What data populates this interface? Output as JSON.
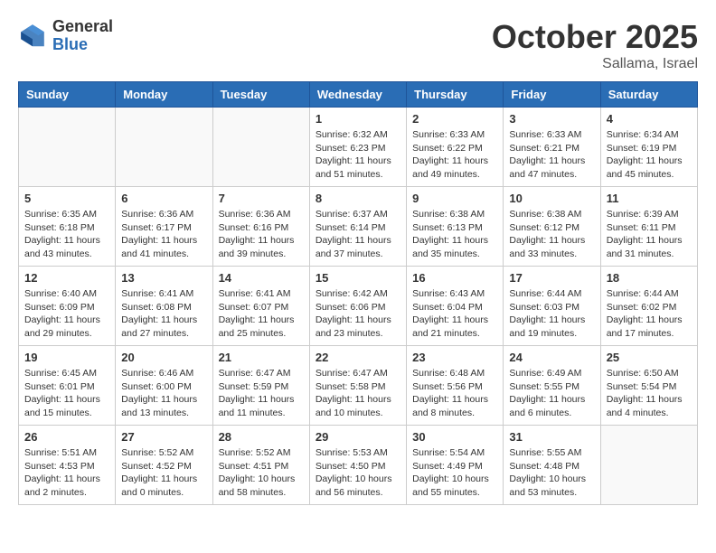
{
  "header": {
    "logo_general": "General",
    "logo_blue": "Blue",
    "month": "October 2025",
    "location": "Sallama, Israel"
  },
  "weekdays": [
    "Sunday",
    "Monday",
    "Tuesday",
    "Wednesday",
    "Thursday",
    "Friday",
    "Saturday"
  ],
  "weeks": [
    [
      {
        "day": "",
        "info": ""
      },
      {
        "day": "",
        "info": ""
      },
      {
        "day": "",
        "info": ""
      },
      {
        "day": "1",
        "info": "Sunrise: 6:32 AM\nSunset: 6:23 PM\nDaylight: 11 hours\nand 51 minutes."
      },
      {
        "day": "2",
        "info": "Sunrise: 6:33 AM\nSunset: 6:22 PM\nDaylight: 11 hours\nand 49 minutes."
      },
      {
        "day": "3",
        "info": "Sunrise: 6:33 AM\nSunset: 6:21 PM\nDaylight: 11 hours\nand 47 minutes."
      },
      {
        "day": "4",
        "info": "Sunrise: 6:34 AM\nSunset: 6:19 PM\nDaylight: 11 hours\nand 45 minutes."
      }
    ],
    [
      {
        "day": "5",
        "info": "Sunrise: 6:35 AM\nSunset: 6:18 PM\nDaylight: 11 hours\nand 43 minutes."
      },
      {
        "day": "6",
        "info": "Sunrise: 6:36 AM\nSunset: 6:17 PM\nDaylight: 11 hours\nand 41 minutes."
      },
      {
        "day": "7",
        "info": "Sunrise: 6:36 AM\nSunset: 6:16 PM\nDaylight: 11 hours\nand 39 minutes."
      },
      {
        "day": "8",
        "info": "Sunrise: 6:37 AM\nSunset: 6:14 PM\nDaylight: 11 hours\nand 37 minutes."
      },
      {
        "day": "9",
        "info": "Sunrise: 6:38 AM\nSunset: 6:13 PM\nDaylight: 11 hours\nand 35 minutes."
      },
      {
        "day": "10",
        "info": "Sunrise: 6:38 AM\nSunset: 6:12 PM\nDaylight: 11 hours\nand 33 minutes."
      },
      {
        "day": "11",
        "info": "Sunrise: 6:39 AM\nSunset: 6:11 PM\nDaylight: 11 hours\nand 31 minutes."
      }
    ],
    [
      {
        "day": "12",
        "info": "Sunrise: 6:40 AM\nSunset: 6:09 PM\nDaylight: 11 hours\nand 29 minutes."
      },
      {
        "day": "13",
        "info": "Sunrise: 6:41 AM\nSunset: 6:08 PM\nDaylight: 11 hours\nand 27 minutes."
      },
      {
        "day": "14",
        "info": "Sunrise: 6:41 AM\nSunset: 6:07 PM\nDaylight: 11 hours\nand 25 minutes."
      },
      {
        "day": "15",
        "info": "Sunrise: 6:42 AM\nSunset: 6:06 PM\nDaylight: 11 hours\nand 23 minutes."
      },
      {
        "day": "16",
        "info": "Sunrise: 6:43 AM\nSunset: 6:04 PM\nDaylight: 11 hours\nand 21 minutes."
      },
      {
        "day": "17",
        "info": "Sunrise: 6:44 AM\nSunset: 6:03 PM\nDaylight: 11 hours\nand 19 minutes."
      },
      {
        "day": "18",
        "info": "Sunrise: 6:44 AM\nSunset: 6:02 PM\nDaylight: 11 hours\nand 17 minutes."
      }
    ],
    [
      {
        "day": "19",
        "info": "Sunrise: 6:45 AM\nSunset: 6:01 PM\nDaylight: 11 hours\nand 15 minutes."
      },
      {
        "day": "20",
        "info": "Sunrise: 6:46 AM\nSunset: 6:00 PM\nDaylight: 11 hours\nand 13 minutes."
      },
      {
        "day": "21",
        "info": "Sunrise: 6:47 AM\nSunset: 5:59 PM\nDaylight: 11 hours\nand 11 minutes."
      },
      {
        "day": "22",
        "info": "Sunrise: 6:47 AM\nSunset: 5:58 PM\nDaylight: 11 hours\nand 10 minutes."
      },
      {
        "day": "23",
        "info": "Sunrise: 6:48 AM\nSunset: 5:56 PM\nDaylight: 11 hours\nand 8 minutes."
      },
      {
        "day": "24",
        "info": "Sunrise: 6:49 AM\nSunset: 5:55 PM\nDaylight: 11 hours\nand 6 minutes."
      },
      {
        "day": "25",
        "info": "Sunrise: 6:50 AM\nSunset: 5:54 PM\nDaylight: 11 hours\nand 4 minutes."
      }
    ],
    [
      {
        "day": "26",
        "info": "Sunrise: 5:51 AM\nSunset: 4:53 PM\nDaylight: 11 hours\nand 2 minutes."
      },
      {
        "day": "27",
        "info": "Sunrise: 5:52 AM\nSunset: 4:52 PM\nDaylight: 11 hours\nand 0 minutes."
      },
      {
        "day": "28",
        "info": "Sunrise: 5:52 AM\nSunset: 4:51 PM\nDaylight: 10 hours\nand 58 minutes."
      },
      {
        "day": "29",
        "info": "Sunrise: 5:53 AM\nSunset: 4:50 PM\nDaylight: 10 hours\nand 56 minutes."
      },
      {
        "day": "30",
        "info": "Sunrise: 5:54 AM\nSunset: 4:49 PM\nDaylight: 10 hours\nand 55 minutes."
      },
      {
        "day": "31",
        "info": "Sunrise: 5:55 AM\nSunset: 4:48 PM\nDaylight: 10 hours\nand 53 minutes."
      },
      {
        "day": "",
        "info": ""
      }
    ]
  ]
}
